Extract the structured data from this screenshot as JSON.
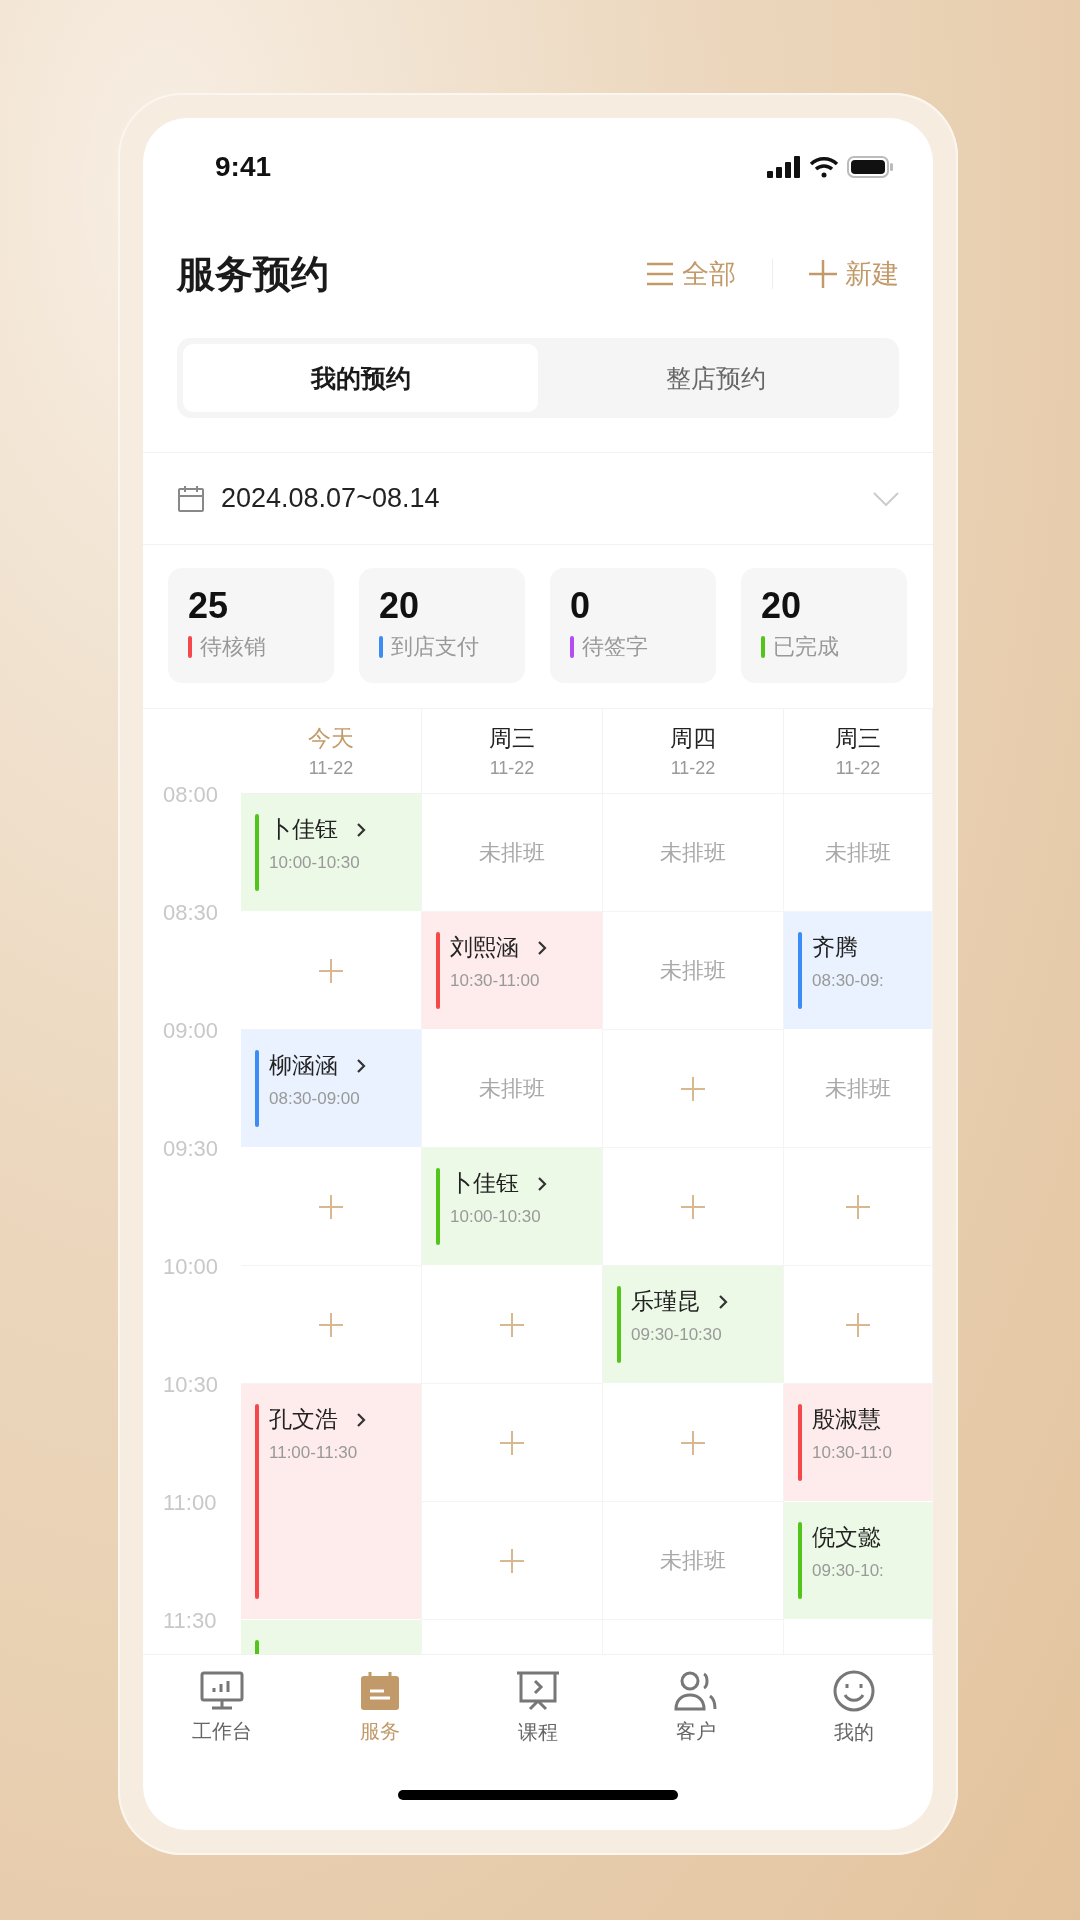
{
  "status_bar": {
    "time": "9:41"
  },
  "header": {
    "title": "服务预约",
    "actions": [
      {
        "kind": "filter",
        "label": "全部"
      },
      {
        "kind": "add",
        "label": "新建"
      }
    ]
  },
  "tabs": [
    {
      "label": "我的预约",
      "selected": true
    },
    {
      "label": "整店预约",
      "selected": false
    }
  ],
  "date_range": "2024.08.07~08.14",
  "stats": [
    {
      "value": "25",
      "label": "待核销",
      "color": "#f5484a"
    },
    {
      "value": "20",
      "label": "到店支付",
      "color": "#3b8cf5"
    },
    {
      "value": "0",
      "label": "待签字",
      "color": "#b44cf5"
    },
    {
      "value": "20",
      "label": "已完成",
      "color": "#52c41a"
    }
  ],
  "calendar": {
    "days": [
      {
        "name": "今天",
        "date": "11-22",
        "selected": true
      },
      {
        "name": "周三",
        "date": "11-22",
        "selected": false
      },
      {
        "name": "周四",
        "date": "11-22",
        "selected": false
      },
      {
        "name": "周三",
        "date": "11-22",
        "selected": false
      }
    ],
    "rows": [
      {
        "time": "08:00",
        "cells": [
          {
            "kind": "event",
            "name": "卜佳钰",
            "time": "10:00-10:30",
            "color": "#52c41a",
            "arrow": true
          },
          {
            "kind": "unscheduled",
            "label": "未排班"
          },
          {
            "kind": "unscheduled",
            "label": "未排班"
          },
          {
            "kind": "unscheduled",
            "label": "未排班"
          }
        ]
      },
      {
        "time": "08:30",
        "cells": [
          {
            "kind": "add"
          },
          {
            "kind": "event",
            "name": "刘熙涵",
            "time": "10:30-11:00",
            "color": "#f5484a",
            "arrow": true
          },
          {
            "kind": "unscheduled",
            "label": "未排班"
          },
          {
            "kind": "event",
            "name": "齐腾",
            "time": "08:30-09:",
            "color": "#3b8cf5",
            "arrow": false
          }
        ]
      },
      {
        "time": "09:00",
        "cells": [
          {
            "kind": "event",
            "name": "柳涵涵",
            "time": "08:30-09:00",
            "color": "#3b8cf5",
            "arrow": true
          },
          {
            "kind": "unscheduled",
            "label": "未排班"
          },
          {
            "kind": "add"
          },
          {
            "kind": "unscheduled",
            "label": "未排班"
          }
        ]
      },
      {
        "time": "09:30",
        "cells": [
          {
            "kind": "add"
          },
          {
            "kind": "event",
            "name": "卜佳钰",
            "time": "10:00-10:30",
            "color": "#52c41a",
            "arrow": true
          },
          {
            "kind": "add"
          },
          {
            "kind": "add"
          }
        ]
      },
      {
        "time": "10:00",
        "cells": [
          {
            "kind": "add"
          },
          {
            "kind": "add"
          },
          {
            "kind": "event",
            "name": "乐瑾昆",
            "time": "09:30-10:30",
            "color": "#52c41a",
            "arrow": true
          },
          {
            "kind": "add"
          }
        ]
      },
      {
        "time": "10:30",
        "cells": [
          {
            "kind": "long_event",
            "name": "孔文浩",
            "time": "11:00-11:30",
            "color": "#f5484a",
            "arrow": true
          },
          {
            "kind": "add"
          },
          {
            "kind": "add"
          },
          {
            "kind": "event",
            "name": "殷淑慧",
            "time": "10:30-11:0",
            "color": "#f5484a",
            "arrow": false
          }
        ]
      },
      {
        "time": "11:00",
        "cells": [
          {
            "kind": "continued"
          },
          {
            "kind": "add"
          },
          {
            "kind": "unscheduled",
            "label": "未排班"
          },
          {
            "kind": "event",
            "name": "倪文懿",
            "time": "09:30-10:",
            "color": "#52c41a",
            "arrow": false
          }
        ]
      },
      {
        "time": "11:30",
        "cells": [
          {
            "kind": "event",
            "color": "#52c41a"
          },
          {
            "kind": "blank"
          },
          {
            "kind": "blank"
          },
          {
            "kind": "blank"
          }
        ]
      }
    ]
  },
  "nav": [
    {
      "kind": "workbench",
      "label": "工作台",
      "selected": false
    },
    {
      "kind": "service",
      "label": "服务",
      "selected": true
    },
    {
      "kind": "course",
      "label": "课程",
      "selected": false
    },
    {
      "kind": "customer",
      "label": "客户",
      "selected": false
    },
    {
      "kind": "mine",
      "label": "我的",
      "selected": false
    }
  ]
}
